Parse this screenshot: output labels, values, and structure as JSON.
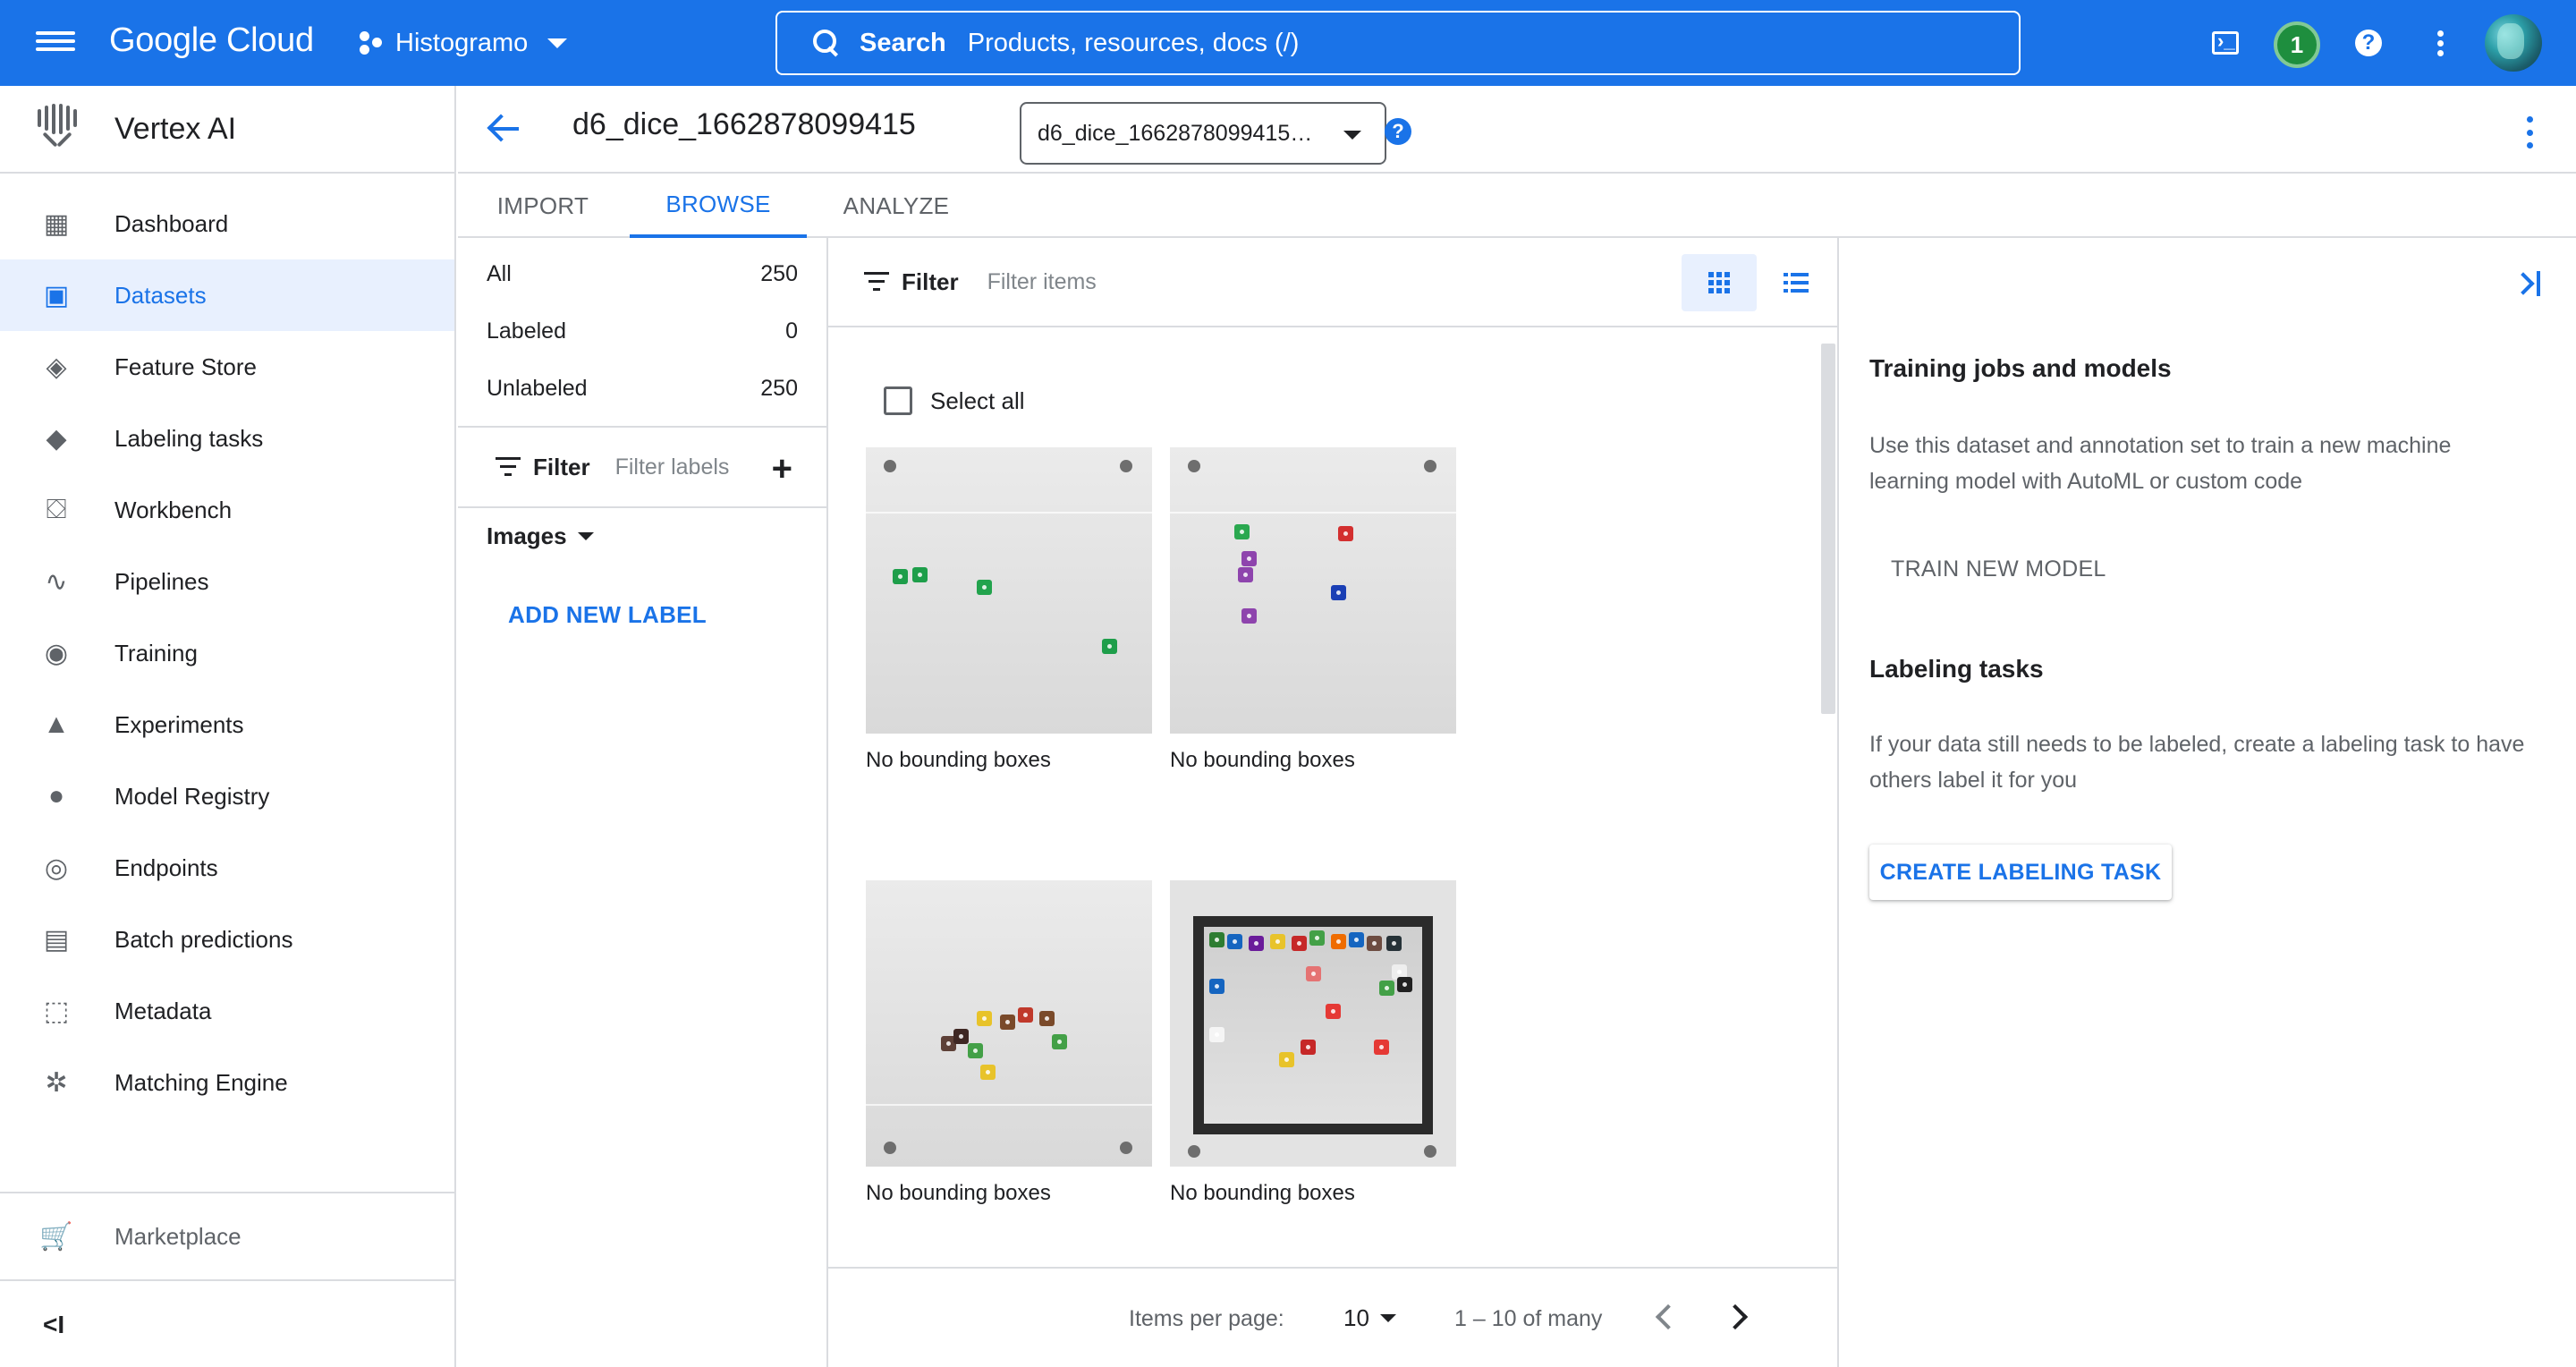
{
  "topbar": {
    "brand": "Google Cloud",
    "project": "Histogramo",
    "search_label": "Search",
    "search_placeholder": "Products, resources, docs (/)",
    "notification_count": "1"
  },
  "leftnav": {
    "product": "Vertex AI",
    "items": [
      {
        "label": "Dashboard",
        "icon": "dashboard-icon",
        "glyph": "▦"
      },
      {
        "label": "Datasets",
        "icon": "datasets-icon",
        "glyph": "▣"
      },
      {
        "label": "Feature Store",
        "icon": "feature-store-icon",
        "glyph": "◈"
      },
      {
        "label": "Labeling tasks",
        "icon": "label-tag-icon",
        "glyph": "◆"
      },
      {
        "label": "Workbench",
        "icon": "workbench-icon",
        "glyph": "⛋"
      },
      {
        "label": "Pipelines",
        "icon": "pipelines-icon",
        "glyph": "∿"
      },
      {
        "label": "Training",
        "icon": "training-icon",
        "glyph": "◉"
      },
      {
        "label": "Experiments",
        "icon": "flask-icon",
        "glyph": "▲"
      },
      {
        "label": "Model Registry",
        "icon": "lightbulb-icon",
        "glyph": "●"
      },
      {
        "label": "Endpoints",
        "icon": "endpoints-icon",
        "glyph": "◎"
      },
      {
        "label": "Batch predictions",
        "icon": "batch-predictions-icon",
        "glyph": "▤"
      },
      {
        "label": "Metadata",
        "icon": "metadata-icon",
        "glyph": "⬚"
      },
      {
        "label": "Matching Engine",
        "icon": "matching-engine-icon",
        "glyph": "✲"
      }
    ],
    "active_index": 1,
    "marketplace": "Marketplace",
    "collapse_glyph": "<I"
  },
  "header": {
    "title": "d6_dice_1662878099415",
    "selector_value": "d6_dice_1662878099415…"
  },
  "tabs": [
    {
      "label": "IMPORT"
    },
    {
      "label": "BROWSE"
    },
    {
      "label": "ANALYZE"
    }
  ],
  "labels_panel": {
    "counts": [
      {
        "label": "All",
        "value": "250"
      },
      {
        "label": "Labeled",
        "value": "0"
      },
      {
        "label": "Unlabeled",
        "value": "250"
      }
    ],
    "filter_label": "Filter",
    "filter_placeholder": "Filter labels",
    "images_dropdown": "Images",
    "add_label": "ADD NEW LABEL"
  },
  "grid": {
    "filter_label": "Filter",
    "filter_placeholder": "Filter items",
    "select_all": "Select all",
    "items": [
      {
        "caption": "No bounding boxes"
      },
      {
        "caption": "No bounding boxes"
      },
      {
        "caption": "No bounding boxes"
      },
      {
        "caption": "No bounding boxes"
      }
    ],
    "pager": {
      "items_per_page_label": "Items per page:",
      "items_per_page_value": "10",
      "range": "1 – 10 of many"
    }
  },
  "right_panel": {
    "training_title": "Training jobs and models",
    "training_text": "Use this dataset and annotation set to train a new machine learning model with AutoML or custom code",
    "train_button": "TRAIN NEW MODEL",
    "labeling_title": "Labeling tasks",
    "labeling_text": "If your data still needs to be labeled, create a labeling task to have others label it for you",
    "labeling_button": "CREATE LABELING TASK"
  },
  "colors": {
    "brand_blue": "#1a73e8",
    "active_bg": "#e8f0fe",
    "divider": "#dadce0"
  }
}
